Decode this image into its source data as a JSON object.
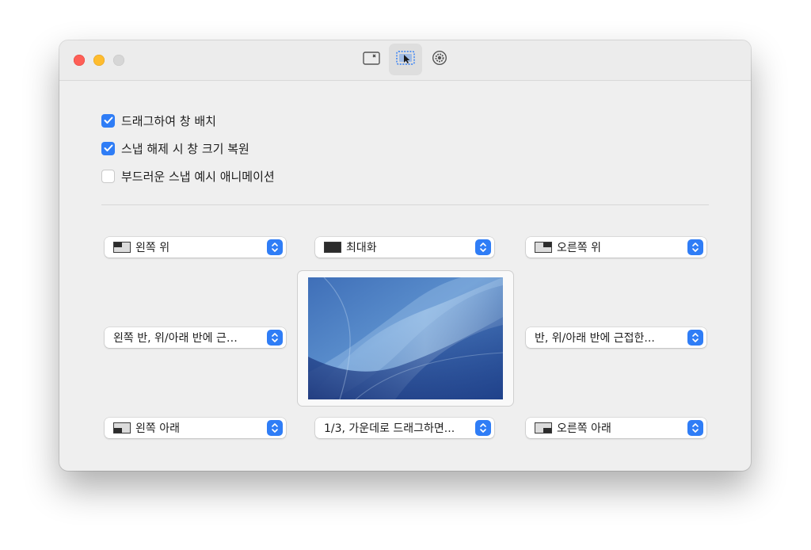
{
  "window": {
    "traffic_lights": [
      "close",
      "minimize",
      "maximize"
    ],
    "toolbar": [
      {
        "icon": "window-close-icon",
        "selected": false
      },
      {
        "icon": "window-cursor-icon",
        "selected": true
      },
      {
        "icon": "gear-icon",
        "selected": false
      }
    ]
  },
  "options": [
    {
      "label": "드래그하여 창 배치",
      "checked": true
    },
    {
      "label": "스냅 해제 시 창 크기 복원",
      "checked": true
    },
    {
      "label": "부드러운 스냅 예시 애니메이션",
      "checked": false
    }
  ],
  "snap_areas": {
    "top_left": {
      "label": "왼쪽 위",
      "icon": "top-left-quarter-icon"
    },
    "top_center": {
      "label": "최대화",
      "icon": "maximize-icon"
    },
    "top_right": {
      "label": "오른쪽 위",
      "icon": "top-right-quarter-icon"
    },
    "middle_left": {
      "label": "왼쪽 반, 위/아래 반에 근…"
    },
    "middle_right": {
      "label": "반, 위/아래 반에 근접한..."
    },
    "bottom_left": {
      "label": "왼쪽 아래",
      "icon": "bottom-left-quarter-icon"
    },
    "bottom_center": {
      "label": "1/3, 가운데로 드래그하면..."
    },
    "bottom_right": {
      "label": "오른쪽 아래",
      "icon": "bottom-right-quarter-icon"
    }
  },
  "colors": {
    "accent": "#2f7df6",
    "close": "#fe5f57",
    "minimize": "#febc2e",
    "maximize": "#d6d6d6"
  }
}
